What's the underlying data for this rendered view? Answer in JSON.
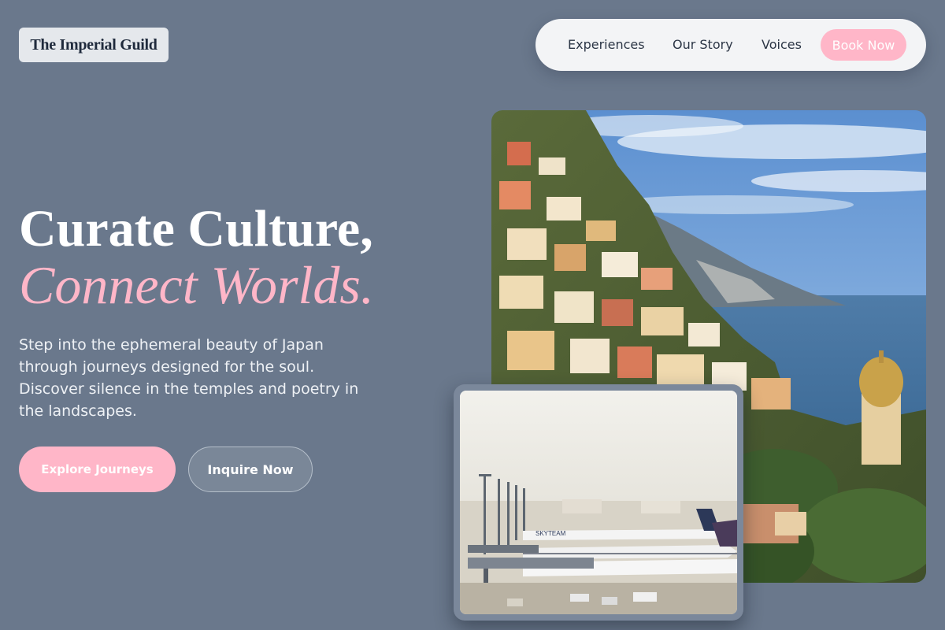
{
  "brand": {
    "name": "The Imperial Guild"
  },
  "nav": {
    "links": [
      "Experiences",
      "Our Story",
      "Voices"
    ],
    "cta": "Book Now"
  },
  "hero": {
    "headline": "Curate Culture,",
    "headline_accent": "Connect Worlds.",
    "description": "Step into the ephemeral beauty of Japan through journeys designed for the soul. Discover silence in the temples and poetry in the landscapes.",
    "primary_button": "Explore Journeys",
    "secondary_button": "Inquire Now"
  },
  "images": {
    "main": "coastal-village-photo",
    "inset": "airport-terminal-photo",
    "inset_tail_text": "SKYTEAM"
  },
  "colors": {
    "background": "#6a788c",
    "accent_pink": "#ffb6c8",
    "nav_background": "#f3f4f6",
    "logo_text": "#1f2a3c"
  }
}
